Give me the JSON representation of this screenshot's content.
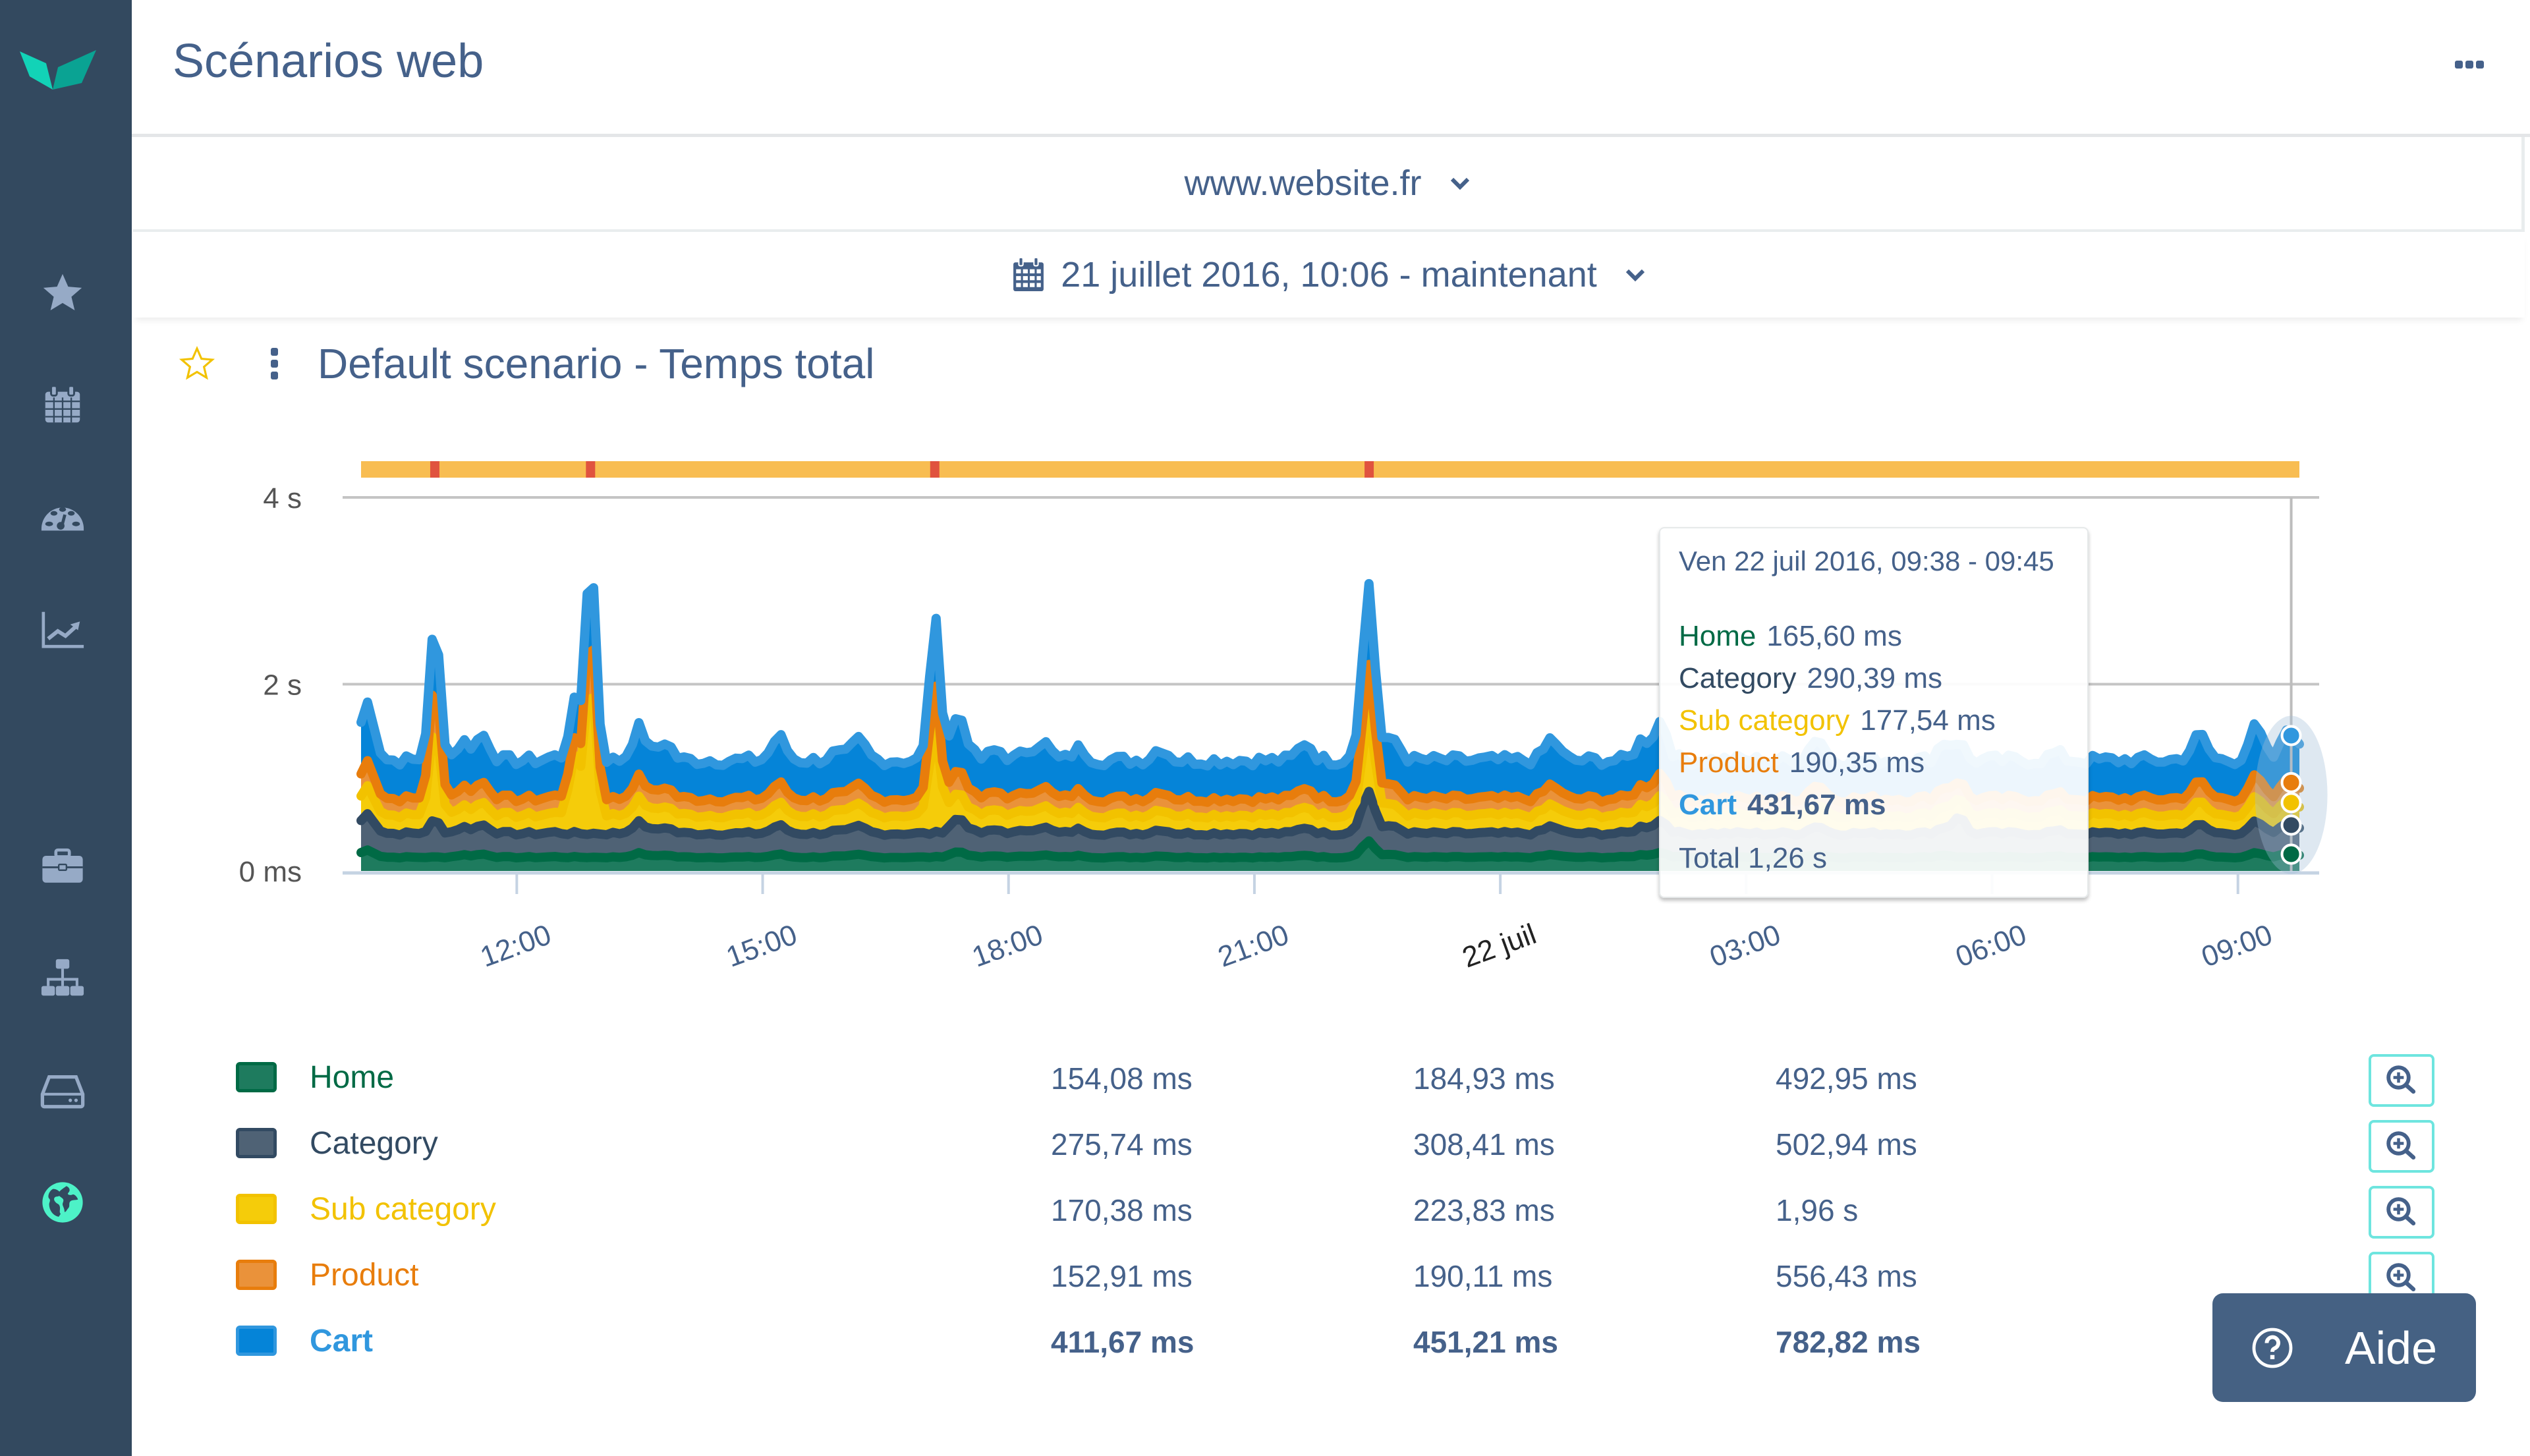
{
  "app": {
    "page_title": "Scénarios web",
    "brand_color": "#1fd3b5",
    "sidebar": {
      "items": [
        {
          "name": "favorites",
          "icon": "star-icon",
          "active": false
        },
        {
          "name": "calendar",
          "icon": "calendar-icon",
          "active": false
        },
        {
          "name": "dashboard",
          "icon": "dashboard-icon",
          "active": false
        },
        {
          "name": "reports",
          "icon": "line-chart-icon",
          "active": false
        },
        {
          "name": "business",
          "icon": "briefcase-icon",
          "active": false
        },
        {
          "name": "network",
          "icon": "sitemap-icon",
          "active": false
        },
        {
          "name": "servers",
          "icon": "hard-drive-icon",
          "active": false
        },
        {
          "name": "web-scenarios",
          "icon": "globe-icon",
          "active": true
        }
      ]
    }
  },
  "filters": {
    "site": "www.website.fr",
    "date_range": "21 juillet 2016, 10:06 - maintenant"
  },
  "chart_card": {
    "title": "Default scenario - Temps total",
    "favorite": false
  },
  "chart_data": {
    "type": "area",
    "stacked": true,
    "title": "Default scenario - Temps total",
    "y_ticks": [
      "0 ms",
      "2 s",
      "4 s"
    ],
    "ylim_ms": [
      0,
      4000
    ],
    "x_ticks": [
      "12:00",
      "15:00",
      "18:00",
      "21:00",
      "22 juil",
      "03:00",
      "06:00",
      "09:00"
    ],
    "x_range_hours": [
      10.1,
      33.75
    ],
    "x_tick_hours": [
      12,
      15,
      18,
      21,
      24,
      27,
      30,
      33
    ],
    "grid": true,
    "status_bar": {
      "color": "#f8bd52",
      "incident_color": "#e0533f",
      "incident_hours": [
        11.0,
        12.9,
        17.1,
        22.4
      ]
    },
    "series": [
      {
        "name": "Home",
        "fill": "#1e7b5e",
        "line": "#006a45",
        "base_ms": 150,
        "spikes": [
          [
            22.4,
            120
          ]
        ]
      },
      {
        "name": "Category",
        "fill": "#4f6275",
        "line": "#324a62",
        "base_ms": 260,
        "spikes": [
          [
            11.0,
            140
          ],
          [
            22.4,
            180
          ],
          [
            29.6,
            180
          ]
        ]
      },
      {
        "name": "Sub category",
        "fill": "#f5cc0a",
        "line": "#f2c200",
        "base_ms": 200,
        "spikes": [
          [
            11.0,
            800
          ],
          [
            12.7,
            600
          ],
          [
            12.9,
            1500
          ],
          [
            17.1,
            900
          ],
          [
            22.4,
            600
          ]
        ]
      },
      {
        "name": "Product",
        "fill": "#ea923a",
        "line": "#e87d0c",
        "base_ms": 180,
        "spikes": [
          [
            11.0,
            300
          ],
          [
            12.9,
            400
          ],
          [
            17.1,
            300
          ],
          [
            22.4,
            250
          ]
        ]
      },
      {
        "name": "Cart",
        "fill": "#0584d8",
        "line": "#3097de",
        "base_ms": 420,
        "spikes": [
          [
            11.0,
            200
          ],
          [
            12.9,
            300
          ],
          [
            17.1,
            300
          ],
          [
            22.4,
            300
          ]
        ]
      }
    ],
    "hover": {
      "hour": 33.65,
      "label": "Ven 22 juil 2016, 09:38 - 09:45",
      "values": [
        {
          "name": "Home",
          "value": "165,60 ms",
          "color": "#006a45"
        },
        {
          "name": "Category",
          "value": "290,39 ms",
          "color": "#324a62"
        },
        {
          "name": "Sub category",
          "value": "177,54 ms",
          "color": "#f2c200"
        },
        {
          "name": "Product",
          "value": "190,35 ms",
          "color": "#e87d0c"
        },
        {
          "name": "Cart",
          "value": "431,67 ms",
          "color": "#3097de",
          "highlighted": true
        }
      ],
      "total": "Total 1,26 s"
    }
  },
  "legend": {
    "rows": [
      {
        "name": "Home",
        "color": "#006a45",
        "fill": "#1e7b5e",
        "min": "154,08 ms",
        "avg": "184,93 ms",
        "max": "492,95 ms",
        "bold": false
      },
      {
        "name": "Category",
        "color": "#324a62",
        "fill": "#4f6275",
        "min": "275,74 ms",
        "avg": "308,41 ms",
        "max": "502,94 ms",
        "bold": false
      },
      {
        "name": "Sub category",
        "color": "#f2c200",
        "fill": "#f5cc0a",
        "min": "170,38 ms",
        "avg": "223,83 ms",
        "max": "1,96 s",
        "bold": false
      },
      {
        "name": "Product",
        "color": "#e87d0c",
        "fill": "#ea923a",
        "min": "152,91 ms",
        "avg": "190,11 ms",
        "max": "556,43 ms",
        "bold": false
      },
      {
        "name": "Cart",
        "color": "#3097de",
        "fill": "#0584d8",
        "min": "411,67 ms",
        "avg": "451,21 ms",
        "max": "782,82 ms",
        "bold": true
      }
    ]
  },
  "help_button": {
    "label": "Aide"
  }
}
